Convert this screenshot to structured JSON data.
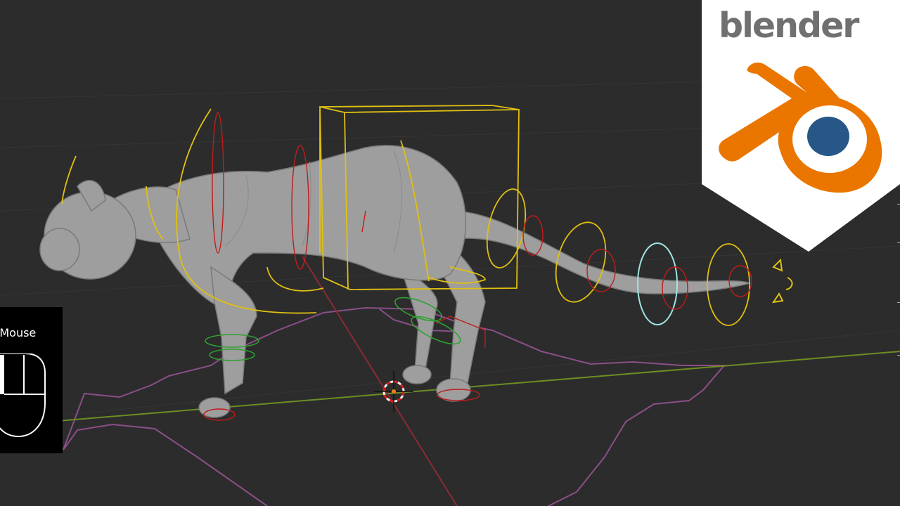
{
  "app": "Blender",
  "viewport": {
    "background": "#2c2c2c",
    "x_axis_color": "#8a2b33",
    "y_axis_color": "#6b8e23",
    "ground_shape_color": "#8a4f88",
    "model_color": "#a0a0a0"
  },
  "input_overlay": {
    "label": "t Mouse",
    "icon": "mouse-icon"
  },
  "logo": {
    "wordmark": "blender",
    "icon": "blender-logo-icon",
    "brand_orange": "#ea7600",
    "brand_blue": "#265787"
  },
  "rig_controls": {
    "yellow": "#e0c012",
    "red": "#c01c1c",
    "green": "#2fa02f",
    "cyan": "#9fe3e3"
  }
}
